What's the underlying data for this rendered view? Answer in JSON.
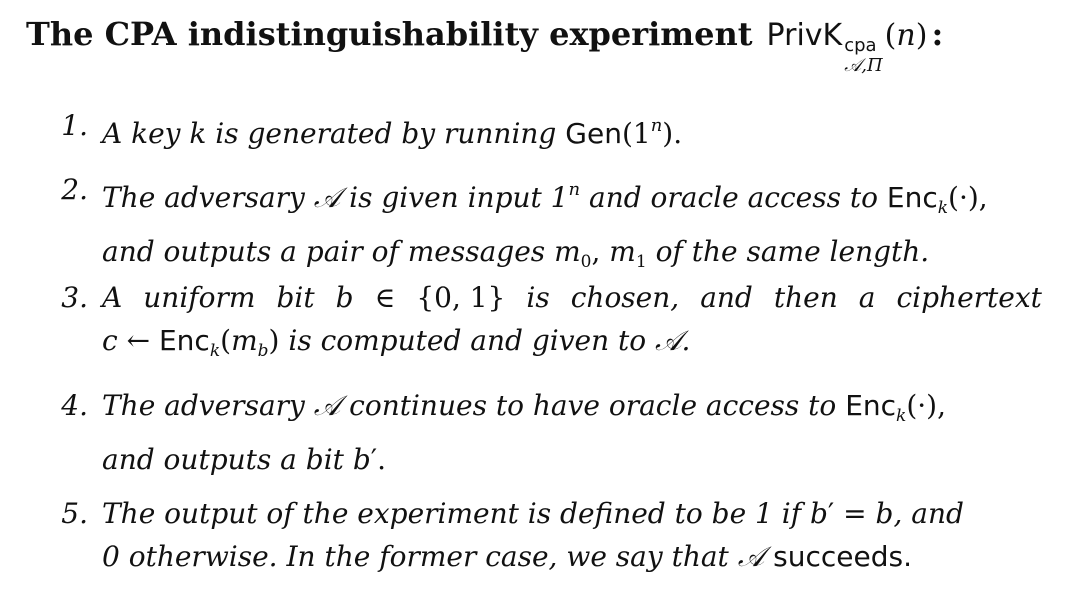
{
  "heading": {
    "title": "The CPA indistinguishability experiment",
    "experiment_name": "PrivK",
    "superscript": "cpa",
    "subscript": "𝒜,Π",
    "argument_open": "(",
    "argument": "n",
    "argument_close": ")",
    "colon": ":"
  },
  "steps": [
    {
      "number": "1.",
      "parts": {
        "p1": "A key",
        "p2": "k",
        "p3": "is generated by running",
        "p4": "Gen",
        "p5": "(1",
        "p6": "n",
        "p7": ")."
      }
    },
    {
      "number": "2.",
      "line1": {
        "p1": "The adversary",
        "p2": "𝒜",
        "p3": "is given input 1",
        "p4": "n",
        "p5": "and oracle access to",
        "p6": "Enc",
        "p7": "k",
        "p8": "(·),"
      },
      "line2": {
        "p1": "and outputs a pair of messages",
        "p2": "m",
        "p3": "0",
        "p4": ",",
        "p5": "m",
        "p6": "1",
        "p7": "of the same length."
      }
    },
    {
      "number": "3.",
      "line1": {
        "w1": "A",
        "w2": "uniform",
        "w3": "bit",
        "w4": "b",
        "w5": "∈",
        "w6": "{0, 1}",
        "w7": "is",
        "w8": "chosen,",
        "w9": "and",
        "w10": "then",
        "w11": "a",
        "w12": "ciphertext"
      },
      "line2": {
        "p1": "c",
        "p2": "←",
        "p3": "Enc",
        "p4": "k",
        "p5": "(",
        "p6": "m",
        "p7": "b",
        "p8": ")",
        "p9": "is computed and given to",
        "p10": "𝒜."
      }
    },
    {
      "number": "4.",
      "line1": {
        "p1": "The adversary",
        "p2": "𝒜",
        "p3": "continues to have oracle access to",
        "p4": "Enc",
        "p5": "k",
        "p6": "(·),"
      },
      "line2": {
        "p1": "and outputs a bit",
        "p2": "b",
        "p3": "′."
      }
    },
    {
      "number": "5.",
      "line1": {
        "p1": "The output of the experiment is defined to be 1 if",
        "p2": "b",
        "p3": "′ =",
        "p4": "b,",
        "p5": "and"
      },
      "line2": {
        "p1": "0 otherwise. In the former case, we say that",
        "p2": "𝒜",
        "p3": "succeeds."
      }
    }
  ]
}
